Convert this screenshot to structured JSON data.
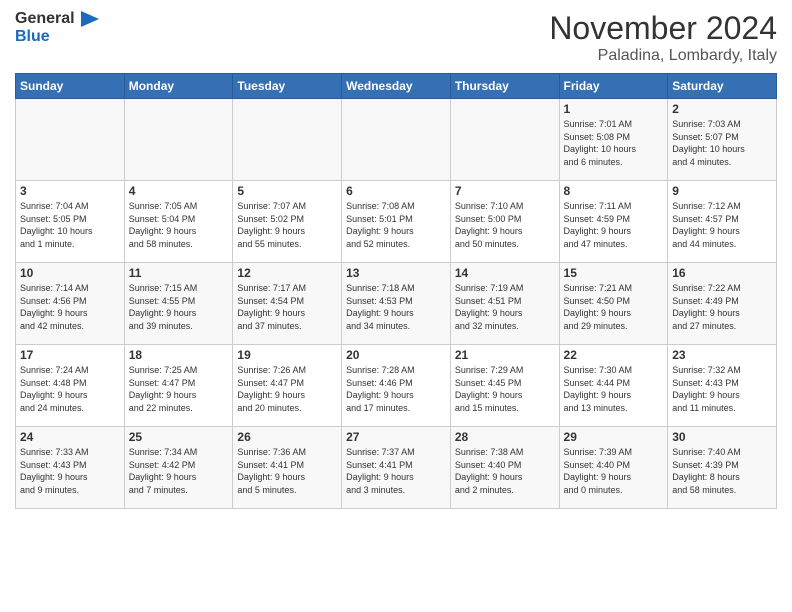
{
  "logo": {
    "line1": "General",
    "line2": "Blue"
  },
  "title": "November 2024",
  "location": "Paladina, Lombardy, Italy",
  "weekdays": [
    "Sunday",
    "Monday",
    "Tuesday",
    "Wednesday",
    "Thursday",
    "Friday",
    "Saturday"
  ],
  "weeks": [
    [
      {
        "day": "",
        "info": ""
      },
      {
        "day": "",
        "info": ""
      },
      {
        "day": "",
        "info": ""
      },
      {
        "day": "",
        "info": ""
      },
      {
        "day": "",
        "info": ""
      },
      {
        "day": "1",
        "info": "Sunrise: 7:01 AM\nSunset: 5:08 PM\nDaylight: 10 hours\nand 6 minutes."
      },
      {
        "day": "2",
        "info": "Sunrise: 7:03 AM\nSunset: 5:07 PM\nDaylight: 10 hours\nand 4 minutes."
      }
    ],
    [
      {
        "day": "3",
        "info": "Sunrise: 7:04 AM\nSunset: 5:05 PM\nDaylight: 10 hours\nand 1 minute."
      },
      {
        "day": "4",
        "info": "Sunrise: 7:05 AM\nSunset: 5:04 PM\nDaylight: 9 hours\nand 58 minutes."
      },
      {
        "day": "5",
        "info": "Sunrise: 7:07 AM\nSunset: 5:02 PM\nDaylight: 9 hours\nand 55 minutes."
      },
      {
        "day": "6",
        "info": "Sunrise: 7:08 AM\nSunset: 5:01 PM\nDaylight: 9 hours\nand 52 minutes."
      },
      {
        "day": "7",
        "info": "Sunrise: 7:10 AM\nSunset: 5:00 PM\nDaylight: 9 hours\nand 50 minutes."
      },
      {
        "day": "8",
        "info": "Sunrise: 7:11 AM\nSunset: 4:59 PM\nDaylight: 9 hours\nand 47 minutes."
      },
      {
        "day": "9",
        "info": "Sunrise: 7:12 AM\nSunset: 4:57 PM\nDaylight: 9 hours\nand 44 minutes."
      }
    ],
    [
      {
        "day": "10",
        "info": "Sunrise: 7:14 AM\nSunset: 4:56 PM\nDaylight: 9 hours\nand 42 minutes."
      },
      {
        "day": "11",
        "info": "Sunrise: 7:15 AM\nSunset: 4:55 PM\nDaylight: 9 hours\nand 39 minutes."
      },
      {
        "day": "12",
        "info": "Sunrise: 7:17 AM\nSunset: 4:54 PM\nDaylight: 9 hours\nand 37 minutes."
      },
      {
        "day": "13",
        "info": "Sunrise: 7:18 AM\nSunset: 4:53 PM\nDaylight: 9 hours\nand 34 minutes."
      },
      {
        "day": "14",
        "info": "Sunrise: 7:19 AM\nSunset: 4:51 PM\nDaylight: 9 hours\nand 32 minutes."
      },
      {
        "day": "15",
        "info": "Sunrise: 7:21 AM\nSunset: 4:50 PM\nDaylight: 9 hours\nand 29 minutes."
      },
      {
        "day": "16",
        "info": "Sunrise: 7:22 AM\nSunset: 4:49 PM\nDaylight: 9 hours\nand 27 minutes."
      }
    ],
    [
      {
        "day": "17",
        "info": "Sunrise: 7:24 AM\nSunset: 4:48 PM\nDaylight: 9 hours\nand 24 minutes."
      },
      {
        "day": "18",
        "info": "Sunrise: 7:25 AM\nSunset: 4:47 PM\nDaylight: 9 hours\nand 22 minutes."
      },
      {
        "day": "19",
        "info": "Sunrise: 7:26 AM\nSunset: 4:47 PM\nDaylight: 9 hours\nand 20 minutes."
      },
      {
        "day": "20",
        "info": "Sunrise: 7:28 AM\nSunset: 4:46 PM\nDaylight: 9 hours\nand 17 minutes."
      },
      {
        "day": "21",
        "info": "Sunrise: 7:29 AM\nSunset: 4:45 PM\nDaylight: 9 hours\nand 15 minutes."
      },
      {
        "day": "22",
        "info": "Sunrise: 7:30 AM\nSunset: 4:44 PM\nDaylight: 9 hours\nand 13 minutes."
      },
      {
        "day": "23",
        "info": "Sunrise: 7:32 AM\nSunset: 4:43 PM\nDaylight: 9 hours\nand 11 minutes."
      }
    ],
    [
      {
        "day": "24",
        "info": "Sunrise: 7:33 AM\nSunset: 4:43 PM\nDaylight: 9 hours\nand 9 minutes."
      },
      {
        "day": "25",
        "info": "Sunrise: 7:34 AM\nSunset: 4:42 PM\nDaylight: 9 hours\nand 7 minutes."
      },
      {
        "day": "26",
        "info": "Sunrise: 7:36 AM\nSunset: 4:41 PM\nDaylight: 9 hours\nand 5 minutes."
      },
      {
        "day": "27",
        "info": "Sunrise: 7:37 AM\nSunset: 4:41 PM\nDaylight: 9 hours\nand 3 minutes."
      },
      {
        "day": "28",
        "info": "Sunrise: 7:38 AM\nSunset: 4:40 PM\nDaylight: 9 hours\nand 2 minutes."
      },
      {
        "day": "29",
        "info": "Sunrise: 7:39 AM\nSunset: 4:40 PM\nDaylight: 9 hours\nand 0 minutes."
      },
      {
        "day": "30",
        "info": "Sunrise: 7:40 AM\nSunset: 4:39 PM\nDaylight: 8 hours\nand 58 minutes."
      }
    ]
  ]
}
